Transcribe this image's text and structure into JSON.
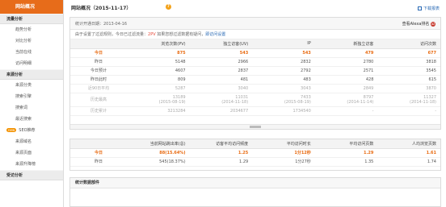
{
  "sidebar": {
    "title": "网站概况",
    "sections": [
      {
        "head": "流量分析",
        "items": [
          "趋势分析",
          "对比分析",
          "当前在线",
          "访问明细"
        ]
      },
      {
        "head": "来源分析",
        "items": [
          "来源分类",
          "搜索引擎",
          "搜索词",
          "最近搜索"
        ]
      }
    ],
    "seo": {
      "badge": "new",
      "label": "SEO推荐"
    },
    "seo_items": [
      "来源域名",
      "来源页面",
      "来源升降榜"
    ],
    "bottom_head": "受访分析"
  },
  "header": {
    "title": "网站概况（2015-11-17）",
    "help": "?",
    "download": "下载报表"
  },
  "panel": {
    "start_date": "统计开通日期：2013-04-16",
    "alexa": "查看Alexa排名",
    "alexa_icon": "az",
    "notice_prefix": "由于设置了过滤规则，今日已过滤流量：",
    "notice_ip": "2PV",
    "notice_suffix": "  如果您想过滤数据有疑问，",
    "notice_link": "即访问设置"
  },
  "table1": {
    "headers": [
      "",
      "浏览次数(PV)",
      "独立访客(UV)",
      "IP",
      "新独立访客",
      "访问次数"
    ],
    "rows": [
      {
        "label": "今日",
        "vals": [
          "875",
          "543",
          "543",
          "479",
          "677"
        ],
        "type": "today"
      },
      {
        "label": "昨日",
        "vals": [
          "5148",
          "2966",
          "2832",
          "2780",
          "3818"
        ],
        "type": ""
      },
      {
        "label": "今日预计",
        "vals": [
          "4607",
          "2837",
          "2792",
          "2571",
          "3545"
        ],
        "type": ""
      },
      {
        "label": "昨日此时",
        "vals": [
          "809",
          "481",
          "483",
          "428",
          "615"
        ],
        "type": ""
      },
      {
        "label": "近90日平均",
        "vals": [
          "5287",
          "3040",
          "3043",
          "2849",
          "3870"
        ],
        "type": "muted"
      }
    ],
    "history": [
      {
        "label": "历史最高",
        "vals": [
          "13189",
          "11031",
          "7433",
          "8797",
          "11327"
        ],
        "dates": [
          "(2015-08-19)",
          "(2014-11-18)",
          "(2015-08-19)",
          "(2014-11-14)",
          "(2014-11-18)"
        ]
      },
      {
        "label": "历史累计",
        "vals": [
          "3213284",
          "2034677",
          "1734540",
          "-",
          "-"
        ]
      }
    ]
  },
  "table2": {
    "headers": [
      "",
      "当前网站跳出率(总)",
      "访客平均访问频度",
      "平均访问时长",
      "平均访问页数",
      "人均浏览页数"
    ],
    "rows": [
      {
        "label": "今日",
        "vals": [
          "88(15.64%)",
          "1.25",
          "1分12秒",
          "1.29",
          "1.61"
        ],
        "type": "today"
      },
      {
        "label": "昨日",
        "vals": [
          "545(18.37%)",
          "1.29",
          "1分27秒",
          "1.35",
          "1.74"
        ],
        "type": ""
      }
    ]
  },
  "panel3": {
    "title": "统计数据部件"
  }
}
